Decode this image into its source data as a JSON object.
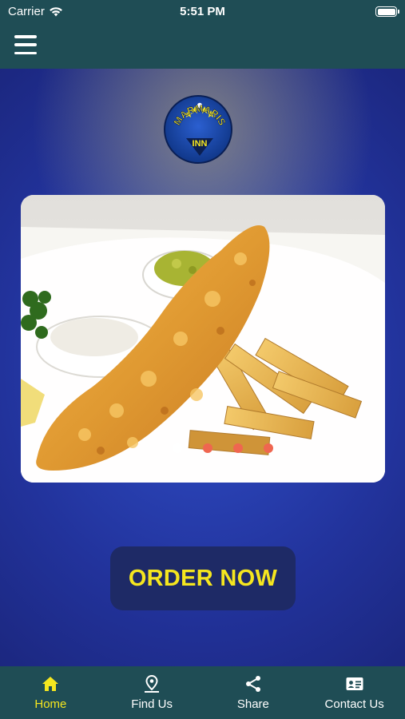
{
  "status_bar": {
    "carrier": "Carrier",
    "time": "5:51 PM"
  },
  "header": {
    "menu_icon": "hamburger-menu-icon"
  },
  "logo": {
    "line1": "MARMARIS",
    "line2": "INN"
  },
  "carousel": {
    "image": "fish-and-chips-photo",
    "active_slide": 1,
    "slide_count": 4
  },
  "order_button": {
    "label": "ORDER NOW"
  },
  "tabs": [
    {
      "label": "Home",
      "icon": "home-icon",
      "active": true
    },
    {
      "label": "Find Us",
      "icon": "location-pin-icon",
      "active": false
    },
    {
      "label": "Share",
      "icon": "share-icon",
      "active": false
    },
    {
      "label": "Contact Us",
      "icon": "contact-card-icon",
      "active": false
    }
  ],
  "colors": {
    "bar": "#1f4d55",
    "accent": "#f5e61f",
    "dot_inactive": "#ef6650",
    "button_bg": "#1e2a66"
  }
}
